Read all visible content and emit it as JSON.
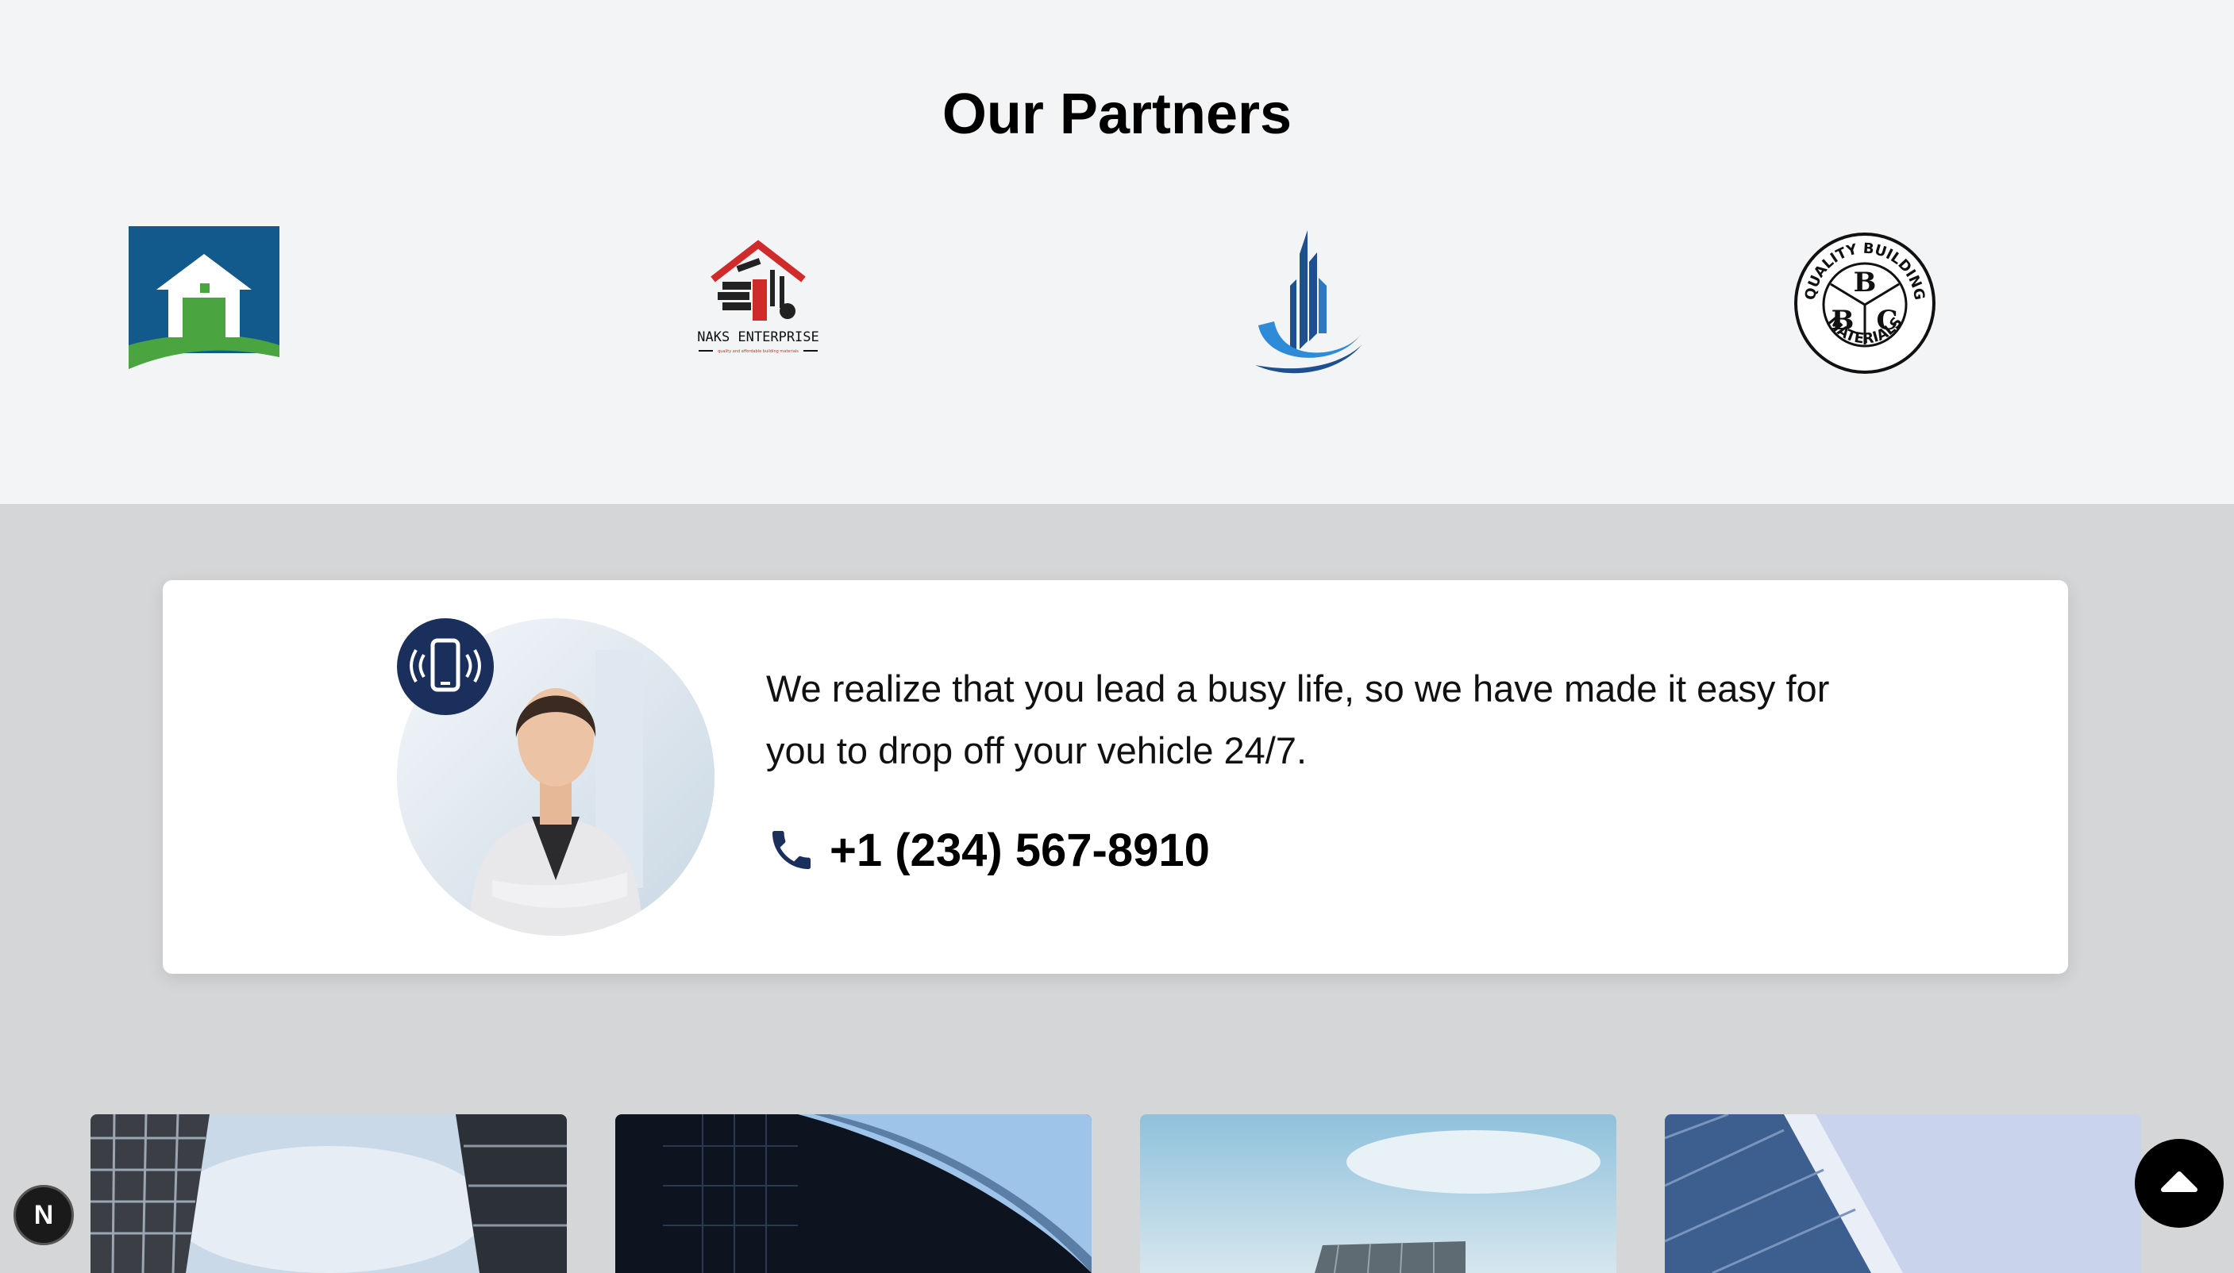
{
  "partners": {
    "title": "Our Partners",
    "logos": [
      {
        "name": "house-logo"
      },
      {
        "name": "naks-enterprise-logo",
        "text": "NAKS ENTERPRISE",
        "tagline": "quality and affordable building materials"
      },
      {
        "name": "tower-swoosh-logo"
      },
      {
        "name": "quality-building-materials-logo",
        "ring_top": "QUALITY BUILDING",
        "ring_bottom": "MATERIALS",
        "letters": [
          "B",
          "B",
          "C"
        ]
      }
    ]
  },
  "contact": {
    "message": "We realize that you lead a busy life, so we have made it easy for you to drop off your vehicle 24/7.",
    "phone": "+1 (234) 567-8910",
    "badge_icon": "phone-vibrate-icon",
    "phone_icon": "phone-icon"
  },
  "gallery": {
    "items": [
      "building-photo-1",
      "building-photo-2",
      "building-photo-3",
      "building-photo-4"
    ]
  },
  "controls": {
    "scroll_top_icon": "arrow-up-icon",
    "dev_badge_text": "N"
  },
  "colors": {
    "partners_bg": "#f3f4f6",
    "page_bg": "#d5d6d8",
    "accent_navy": "#1b2f5c"
  }
}
